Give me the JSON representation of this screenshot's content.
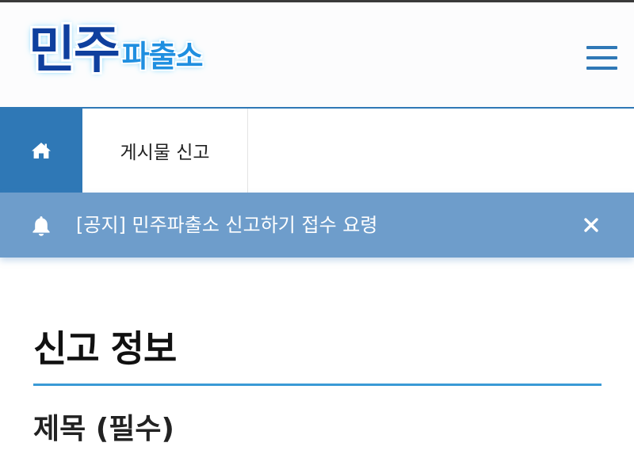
{
  "header": {
    "logo_main": "민주",
    "logo_sub": "파출소",
    "menu_icon": "hamburger-menu-icon"
  },
  "breadcrumb": {
    "home_icon": "home-icon",
    "current": "게시물 신고"
  },
  "notice": {
    "bell_icon": "bell-icon",
    "text": "[공지] 민주파출소 신고하기 접수 요령",
    "close_icon": "close-icon"
  },
  "form": {
    "section_title": "신고 정보",
    "field_title_label": "제목 (필수)"
  },
  "colors": {
    "primary": "#2f78b6",
    "notice_bg": "#6e9dcb",
    "rule": "#3a9ad6",
    "logo_main": "#0f3f9e",
    "logo_sub": "#1f8fe0"
  }
}
